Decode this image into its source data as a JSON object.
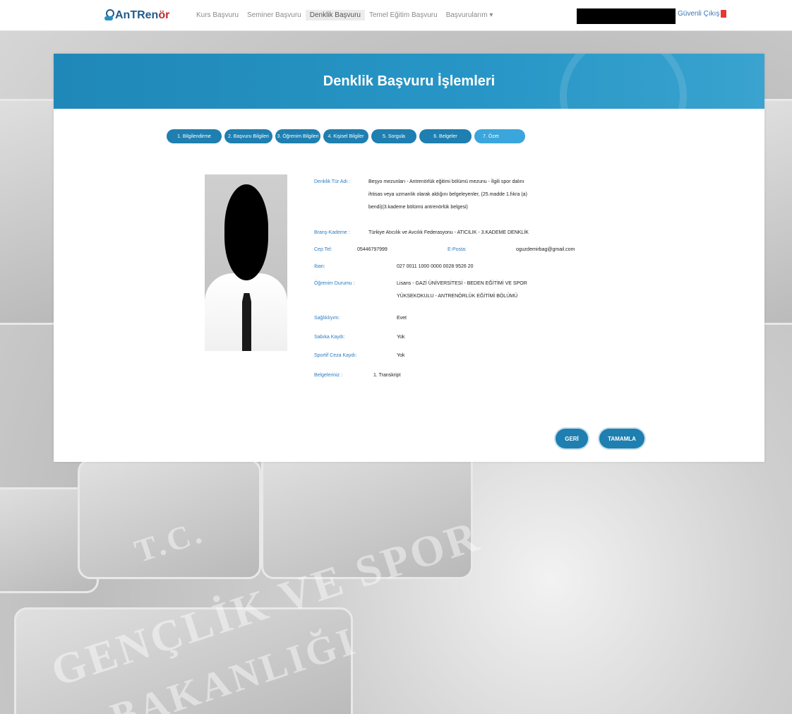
{
  "nav": {
    "logo_prefix": "AnTRen",
    "logo_suffix": "ör",
    "items": [
      {
        "label": "Kurs Başvuru"
      },
      {
        "label": "Seminer Başvuru"
      },
      {
        "label": "Denklik Başvuru"
      },
      {
        "label": "Temel Eğitim Başvuru"
      },
      {
        "label": "Başvurularım ▾"
      }
    ],
    "logout_label": "Güvenli Çıkış"
  },
  "page": {
    "title": "Denklik Başvuru İşlemleri"
  },
  "steps": [
    {
      "label": "1. Bilgilendirme"
    },
    {
      "label": "2. Başvuru Bilgileri"
    },
    {
      "label": "3. Öğrenim Bilgileri"
    },
    {
      "label": "4. Kişisel Bilgiler"
    },
    {
      "label": "5. Sorgula"
    },
    {
      "label": "6. Belgeler"
    },
    {
      "label": "7. Özet"
    }
  ],
  "summary": {
    "denklik_turu_label": "Denklik Tür Adı :",
    "denklik_turu_value_1": "Beşyo mezunları - Antrenörlük eğitimi bölümü mezunu - İlgili spor dalını",
    "denklik_turu_value_2": "ihtisas veya uzmanlık olarak aldığını belgeleyenler, (25.madde 1.fıkra (a)",
    "denklik_turu_value_3": "bendi)(3.kademe bölümü antrenörlük belgesi)",
    "brans_label": "Branş-Kademe :",
    "brans_value": "Türkiye Atıcılık ve Avcılık Federasyonu - ATICILIK - 3.KADEME DENKLİK",
    "cep_label": "Cep Tel:",
    "cep_value": "05446797999",
    "eposta_label": "E-Posta:",
    "eposta_value": "oguzdemirbag@gmail.com",
    "iban_label": "Iban:",
    "iban_value": "027 0011 1000 0000 0028 9526 20",
    "ogrenim_label": "Öğrenim Durumu :",
    "ogrenim_value_1": "Lisans - GAZİ ÜNİVERSİTESİ - BEDEN EĞİTİMİ VE SPOR",
    "ogrenim_value_2": "YÜKSEKOKULU - ANTRENÖRLÜK EĞİTİMİ BÖLÜMÜ",
    "saglik_label": "Sağlıklıyım:",
    "saglik_value": "Evet",
    "sabika_label": "Sabıka Kaydı:",
    "sabika_value": "Yok",
    "sportif_label": "Sportif Ceza Kaydı:",
    "sportif_value": "Yok",
    "belge_label": "Belgeleriniz :",
    "belge_value": "1. Transkript"
  },
  "buttons": {
    "back": "GERİ",
    "complete": "TAMAMLA"
  },
  "watermark": {
    "line1": "T.C.",
    "line2": "GENÇLİK VE SPOR",
    "line3": "BAKANLIĞI"
  }
}
